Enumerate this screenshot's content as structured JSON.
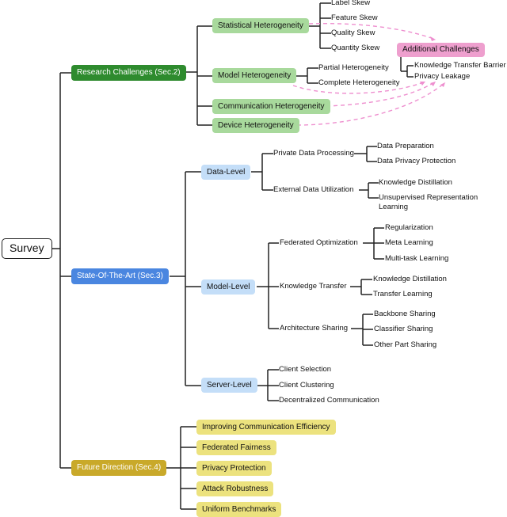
{
  "root": {
    "label": "Survey"
  },
  "research": {
    "label": "Research Challenges (Sec.2)",
    "statistical": {
      "label": "Statistical Heterogeneity",
      "children": [
        "Label Skew",
        "Feature Skew",
        "Quality Skew",
        "Quantity Skew"
      ]
    },
    "model": {
      "label": "Model Heterogeneity",
      "children": [
        "Partial Heterogeneity",
        "Complete Heterogeneity"
      ]
    },
    "communication": {
      "label": "Communication Heterogeneity"
    },
    "device": {
      "label": "Device Heterogeneity"
    },
    "additional": {
      "label": "Additional Challenges",
      "children": [
        "Knowledge Transfer Barrier",
        "Privacy Leakage"
      ]
    }
  },
  "sota": {
    "label": "State-Of-The-Art (Sec.3)",
    "data_level": {
      "label": "Data-Level",
      "private": {
        "label": "Private Data Processing",
        "children": [
          "Data Preparation",
          "Data Privacy Protection"
        ]
      },
      "external": {
        "label": "External Data Utilization",
        "children": [
          "Knowledge Distillation",
          "Unsupervised Representation",
          "Learning"
        ]
      }
    },
    "model_level": {
      "label": "Model-Level",
      "fedopt": {
        "label": "Federated Optimization",
        "children": [
          "Regularization",
          "Meta Learning",
          "Multi-task Learning"
        ]
      },
      "kt": {
        "label": "Knowledge Transfer",
        "children": [
          "Knowledge Distillation",
          "Transfer Learning"
        ]
      },
      "arch": {
        "label": "Architecture Sharing",
        "children": [
          "Backbone Sharing",
          "Classifier Sharing",
          "Other Part Sharing"
        ]
      }
    },
    "server_level": {
      "label": "Server-Level",
      "children": [
        "Client Selection",
        "Client Clustering",
        "Decentralized Communication"
      ]
    }
  },
  "future": {
    "label": "Future Direction (Sec.4)",
    "children": [
      "Improving Communication Efficiency",
      "Federated Fairness",
      "Privacy Protection",
      "Attack Robustness",
      "Uniform Benchmarks"
    ]
  },
  "colors": {
    "research": "#2e8b2e",
    "sota": "#4a86e0",
    "future": "#c9a92a",
    "arrow": "#ee8fcf"
  }
}
